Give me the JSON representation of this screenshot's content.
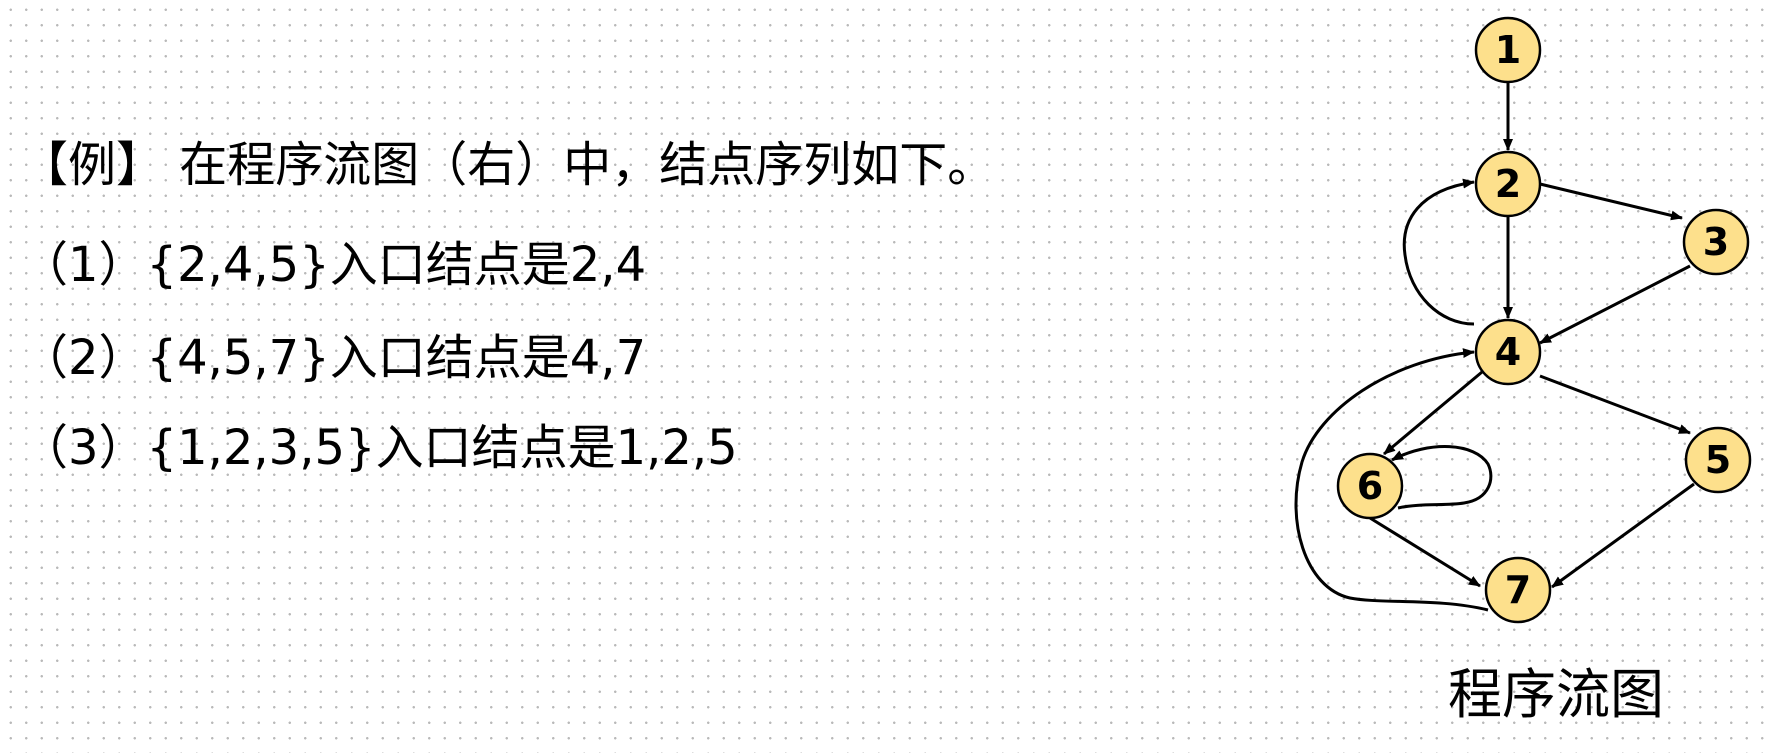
{
  "intro": "【例】  在程序流图（右）中，结点序列如下。",
  "items": [
    {
      "index": "（1）",
      "set": "{2,4,5}",
      "text": "入口结点是2,4"
    },
    {
      "index": "（2）",
      "set": "{4,5,7}",
      "text": "入口结点是4,7"
    },
    {
      "index": "（3）",
      "set": "{1,2,3,5}",
      "text": "入口结点是1,2,5"
    }
  ],
  "graph": {
    "node_fill": "#fde08c",
    "node_stroke": "#000000",
    "nodes": [
      "1",
      "2",
      "3",
      "4",
      "5",
      "6",
      "7"
    ],
    "edges": [
      {
        "from": "1",
        "to": "2"
      },
      {
        "from": "2",
        "to": "3"
      },
      {
        "from": "2",
        "to": "4"
      },
      {
        "from": "3",
        "to": "4"
      },
      {
        "from": "4",
        "to": "2"
      },
      {
        "from": "4",
        "to": "5"
      },
      {
        "from": "4",
        "to": "6"
      },
      {
        "from": "6",
        "to": "6"
      },
      {
        "from": "6",
        "to": "7"
      },
      {
        "from": "5",
        "to": "7"
      },
      {
        "from": "7",
        "to": "4"
      }
    ],
    "caption": "程序流图"
  }
}
